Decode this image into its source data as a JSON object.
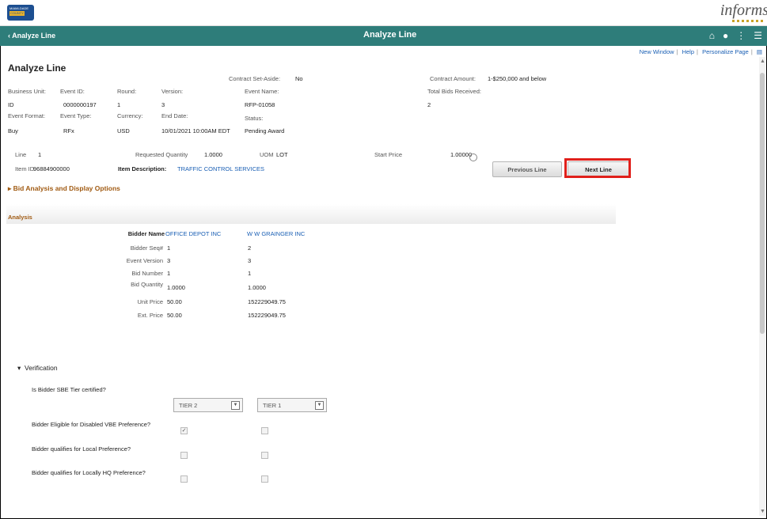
{
  "branding": {
    "org_logo_line1": "MIAMI-DADE",
    "org_logo_line2": "COUNTY",
    "product": "informs"
  },
  "header": {
    "back_label": "Analyze Line",
    "title": "Analyze Line"
  },
  "links": {
    "new_window": "New Window",
    "help": "Help",
    "personalize": "Personalize Page"
  },
  "page": {
    "title": "Analyze Line"
  },
  "event": {
    "contract_set_aside_label": "Contract Set-Aside:",
    "contract_set_aside": "No",
    "contract_amount_label": "Contract Amount:",
    "contract_amount": "1-$250,000 and below",
    "business_unit_label": "Business Unit:",
    "business_unit": "ID",
    "event_id_label": "Event ID:",
    "event_id": "0000000197",
    "round_label": "Round:",
    "round": "1",
    "version_label": "Version:",
    "version": "3",
    "event_name_label": "Event Name:",
    "event_name": "RFP-01058",
    "total_bids_label": "Total Bids Received:",
    "total_bids": "2",
    "event_format_label": "Event Format:",
    "event_format": "Buy",
    "event_type_label": "Event Type:",
    "event_type": "RFx",
    "currency_label": "Currency:",
    "currency": "USD",
    "end_date_label": "End Date:",
    "end_date": "10/01/2021 10:00AM EDT",
    "status_label": "Status:",
    "status": "Pending Award"
  },
  "line": {
    "line_label": "Line",
    "line": "1",
    "req_qty_label": "Requested Quantity",
    "req_qty": "1.0000",
    "uom_label": "UOM",
    "uom": "LOT",
    "start_price_label": "Start Price",
    "start_price": "1.00000",
    "item_id_label": "Item ID",
    "item_id": "96884900000",
    "item_desc_label": "Item Description:",
    "item_desc": "TRAFFIC CONTROL SERVICES",
    "prev_button": "Previous Line",
    "next_button": "Next Line"
  },
  "bid_options_label": "Bid Analysis and Display Options",
  "analysis": {
    "section_label": "Analysis",
    "row_labels": {
      "bidder_name": "Bidder Name",
      "bidder_seq": "Bidder Seq#",
      "event_version": "Event Version",
      "bid_number": "Bid Number",
      "bid_quantity": "Bid Quantity",
      "unit_price": "Unit Price",
      "ext_price": "Ext. Price"
    },
    "bidders": [
      {
        "name": "OFFICE DEPOT INC",
        "seq": "1",
        "event_version": "3",
        "bid_number": "1",
        "bid_quantity": "1.0000",
        "unit_price": "50.00",
        "ext_price": "50.00"
      },
      {
        "name": "W W GRAINGER INC",
        "seq": "2",
        "event_version": "3",
        "bid_number": "1",
        "bid_quantity": "1.0000",
        "unit_price": "152229049.75",
        "ext_price": "152229049.75"
      }
    ]
  },
  "verification": {
    "label": "Verification",
    "q_sbe": "Is Bidder SBE Tier certified?",
    "tier_bidder1": "TIER 2",
    "tier_bidder2": "TIER 1",
    "q_vbe": "Bidder Eligible for Disabled VBE Preference?",
    "q_local": "Bidder qualifies for Local Preference?",
    "q_hq": "Bidder qualifies for Locally HQ Preference?",
    "vbe_checked": [
      true,
      false
    ],
    "local_checked": [
      false,
      false
    ],
    "hq_checked": [
      false,
      false
    ]
  }
}
